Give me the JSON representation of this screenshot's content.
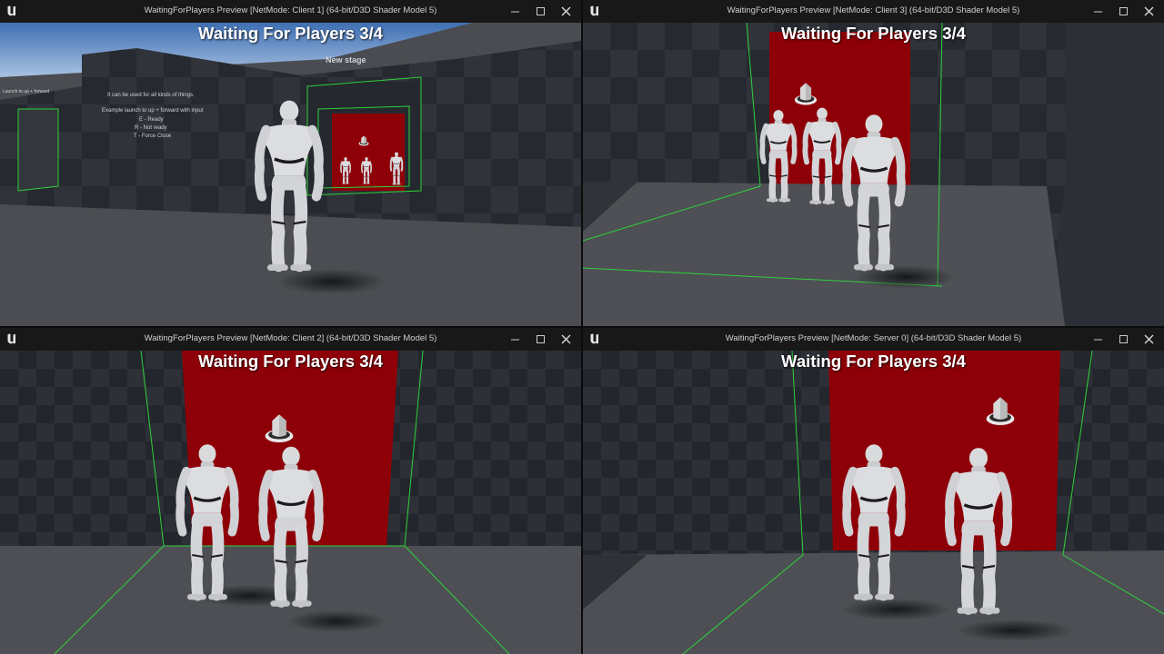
{
  "windows": [
    {
      "title": "WaitingForPlayers Preview [NetMode: Client 1]  (64-bit/D3D Shader Model 5)",
      "overlay": "Waiting For Players 3/4"
    },
    {
      "title": "WaitingForPlayers Preview [NetMode: Client 3]  (64-bit/D3D Shader Model 5)",
      "overlay": "Waiting For Players 3/4"
    },
    {
      "title": "WaitingForPlayers Preview [NetMode: Client 2]  (64-bit/D3D Shader Model 5)",
      "overlay": "Waiting For Players 3/4"
    },
    {
      "title": "WaitingForPlayers Preview [NetMode: Server 0]  (64-bit/D3D Shader Model 5)",
      "overlay": "Waiting For Players 3/4"
    }
  ],
  "scene_text": {
    "new_stage": "New stage",
    "launch_label": "Launch to up + forward",
    "info_line1": "It can be used for all kinds of things.",
    "info_line2": "Example launch to up + forward with input",
    "key_e": "E - Ready",
    "key_r": "R - Not ready",
    "key_t": "T - Force Close"
  },
  "colors": {
    "red_backdrop": "#8e0008",
    "trigger_green": "#2fd13a",
    "floor": "#4b4d52",
    "wall": "#2a2d33",
    "sky": "#5f8fc8"
  },
  "icons": {
    "logo": "unreal-engine-logo-icon",
    "minimize": "minimize-icon",
    "maximize": "maximize-icon",
    "close": "close-icon"
  }
}
